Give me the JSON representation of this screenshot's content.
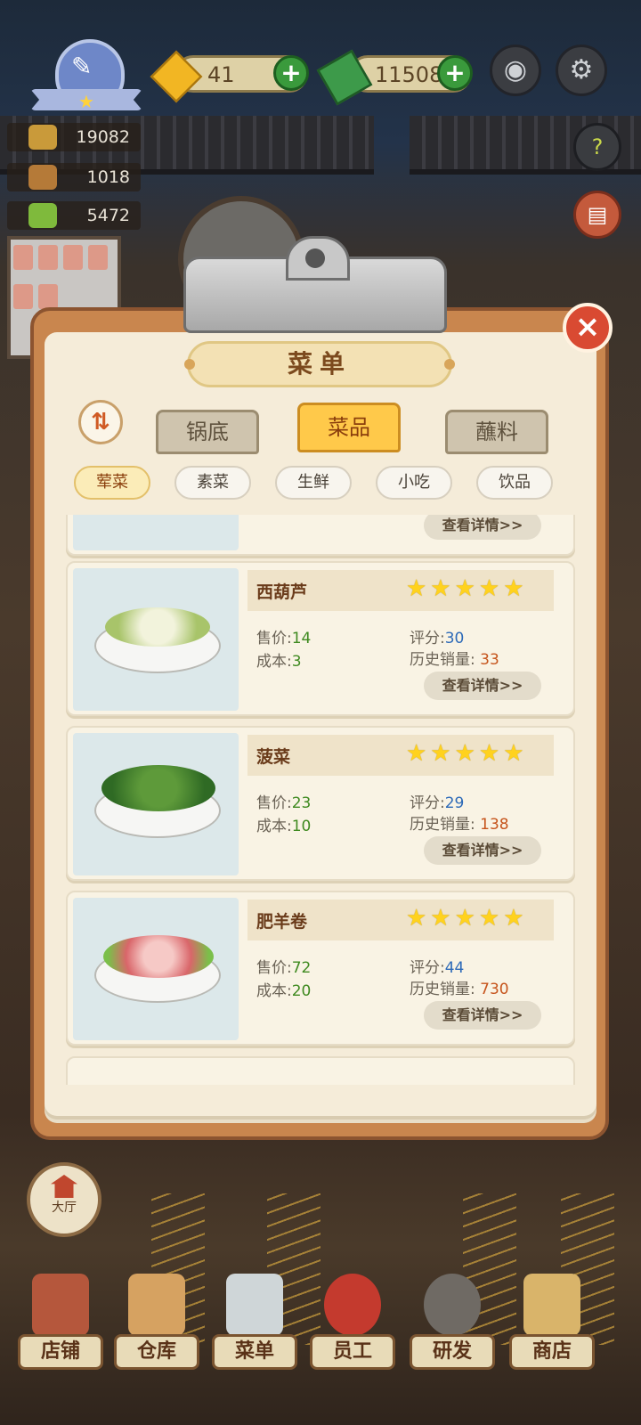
{
  "hud": {
    "gems": "41",
    "cash": "11508",
    "stats": [
      "19082",
      "1018",
      "5472"
    ]
  },
  "menu": {
    "title": "菜单",
    "tabs": [
      "锅底",
      "菜品",
      "蘸料"
    ],
    "active_tab": "菜品",
    "chips": [
      "荤菜",
      "素菜",
      "生鲜",
      "小吃",
      "饮品"
    ],
    "active_chip": "荤菜",
    "labels": {
      "price": "售价",
      "cost": "成本",
      "rating": "评分",
      "sales": "历史销量",
      "detail": "查看详情>>"
    },
    "items": [
      {
        "name": "西葫芦",
        "stars": 5,
        "price": "14",
        "cost": "3",
        "rating": "30",
        "sales": "33"
      },
      {
        "name": "菠菜",
        "stars": 5,
        "price": "23",
        "cost": "10",
        "rating": "29",
        "sales": "138"
      },
      {
        "name": "肥羊卷",
        "stars": 5,
        "price": "72",
        "cost": "20",
        "rating": "44",
        "sales": "730"
      }
    ]
  },
  "hall_button": "大厅",
  "bottom_nav": [
    "店铺",
    "仓库",
    "菜单",
    "员工",
    "研发",
    "商店"
  ],
  "icons": {
    "camera": "camera-icon",
    "settings": "gear-icon",
    "help": "help-book-icon",
    "close": "close-icon",
    "sort": "sort-icon"
  },
  "colors": {
    "accent_tab": "#ffc94a",
    "price_value": "#3f8a20",
    "rating_value": "#2d6ab8",
    "sales_value": "#c6541c"
  }
}
